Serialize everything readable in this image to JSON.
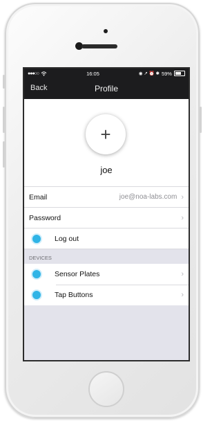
{
  "status_bar": {
    "signal": "●●●○○",
    "wifi": "wifi-icon",
    "time": "16:05",
    "icons": "◉ ↗ ⏰ ✱",
    "battery": "59%"
  },
  "nav": {
    "back_label": "Back",
    "title": "Profile"
  },
  "profile": {
    "add_photo_symbol": "+",
    "username": "joe"
  },
  "account_rows": [
    {
      "label": "Email",
      "value": "joe@noa-labs.com",
      "chevron": "›"
    },
    {
      "label": "Password",
      "value": "",
      "chevron": "›"
    },
    {
      "label": "Log out"
    }
  ],
  "devices": {
    "header": "DEVICES",
    "items": [
      {
        "label": "Sensor Plates",
        "chevron": "›"
      },
      {
        "label": "Tap Buttons",
        "chevron": "›"
      }
    ]
  },
  "colors": {
    "accent": "#2fb4e6",
    "nav_bg": "#1c1c1e",
    "group_bg": "#e3e3eb"
  }
}
